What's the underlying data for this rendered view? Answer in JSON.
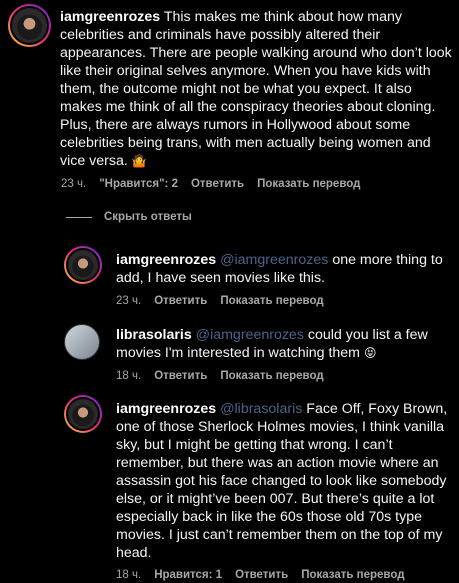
{
  "comments": [
    {
      "username": "iamgreenrozes",
      "mention": "",
      "text": "This makes me think about how many celebrities and criminals have possibly altered their appearances. There are people walking around who don’t look like their original selves anymore. When you have kids with them, the outcome might not be what you expect. It also makes me think of all the conspiracy theories about cloning. Plus, there are always rumors in Hollywood about some celebrities being trans, with men actually being women and vice versa.",
      "emoji": "🤷",
      "time": "23 ч.",
      "likes": "\"Нравится\": 2",
      "reply": "Ответить",
      "translate": "Показать перевод"
    },
    {
      "username": "iamgreenrozes",
      "mention": "@iamgreenrozes",
      "text": "one more thing to add, I have seen movies like this.",
      "time": "23 ч.",
      "reply": "Ответить",
      "translate": "Показать перевод"
    },
    {
      "username": "librasolaris",
      "mention": "@iamgreenrozes",
      "text": "could you list a few movies I'm interested in watching them",
      "emoji": "😝",
      "time": "18 ч.",
      "reply": "Ответить",
      "translate": "Показать перевод"
    },
    {
      "username": "iamgreenrozes",
      "mention": "@librasolaris",
      "text": "Face Off, Foxy Brown, one of those Sherlock Holmes movies, I think vanilla sky, but I might be getting that wrong. I can’t remember, but there was an action movie where an assassin got his face changed to look like somebody else, or it might’ve been 007. But there’s quite a lot especially back in like the 60s those old 70s type movies. I just can’t remember them on the top of my head.",
      "time": "18 ч.",
      "likes": "Нравится: 1",
      "reply": "Ответить",
      "translate": "Показать перевод"
    }
  ],
  "hide_replies": "Скрыть ответы",
  "colors": {
    "meta": "#a8a8a8",
    "mention": "#8ab4f8",
    "ring": "#ee2a7b"
  }
}
